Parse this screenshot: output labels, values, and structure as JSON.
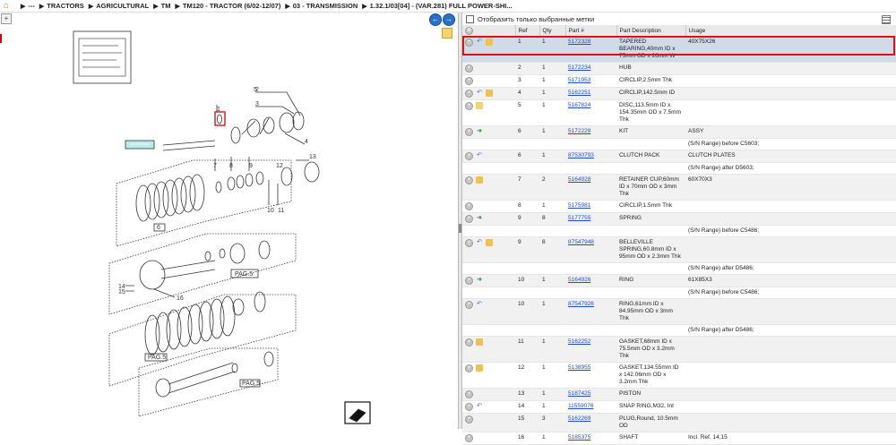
{
  "breadcrumb": {
    "items": [
      "---",
      "TRACTORS",
      "AGRICULTURAL",
      "TM",
      "TM120 - TRACTOR (6/02-12/07)",
      "03 - TRANSMISSION",
      "1.32.1/03[04] - (VAR.281) FULL POWER-SHI..."
    ]
  },
  "left": {
    "expand_icon": "+",
    "nav_back": "←",
    "nav_forward": "→"
  },
  "diagram": {
    "labels": [
      "1",
      "2",
      "3",
      "4",
      "5",
      "6",
      "7",
      "8",
      "9",
      "10",
      "11",
      "12",
      "13",
      "14",
      "15",
      "16"
    ],
    "page_labels": [
      "6",
      "PAG.5",
      "PAG.5",
      "PAG.5"
    ]
  },
  "right": {
    "filter_label": "Отобразить только выбранные метки",
    "columns": [
      "",
      "Ref",
      "Qty",
      "Part #",
      "Part Description",
      "Usage"
    ],
    "rows": [
      {
        "icons": [
          "back",
          "box"
        ],
        "ref": "1",
        "qty": "1",
        "part": "5172328",
        "desc": "TAPERED BEARING,40mm ID x 75mm OD x 26mm W",
        "usage": "40X75X26",
        "sel": true
      },
      {
        "icons": [],
        "ref": "2",
        "qty": "1",
        "part": "5172234",
        "desc": "HUB",
        "usage": ""
      },
      {
        "icons": [],
        "ref": "3",
        "qty": "1",
        "part": "5171953",
        "desc": "CIRCLIP,2.5mm Thk",
        "usage": ""
      },
      {
        "icons": [
          "back",
          "box"
        ],
        "ref": "4",
        "qty": "1",
        "part": "5162251",
        "desc": "CIRCLIP,142.5mm ID",
        "usage": ""
      },
      {
        "icons": [
          "note"
        ],
        "ref": "5",
        "qty": "1",
        "part": "5167824",
        "desc": "DISC,113.5mm ID x 154.35mm OD x 7.5mm Thk",
        "usage": ""
      },
      {
        "icons": [
          "green"
        ],
        "ref": "6",
        "qty": "1",
        "part": "5172229",
        "desc": "KIT",
        "usage": "ASSY"
      },
      {
        "icons": [],
        "ref": "",
        "qty": "",
        "part": "",
        "desc": "",
        "usage": "(S/N Range) before C5603;",
        "blank": true
      },
      {
        "icons": [
          "back"
        ],
        "ref": "6",
        "qty": "1",
        "part": "87530793",
        "desc": "CLUTCH PACK",
        "usage": "CLUTCH PLATES"
      },
      {
        "icons": [],
        "ref": "",
        "qty": "",
        "part": "",
        "desc": "",
        "usage": "(S/N Range) after D5603;",
        "blank": true
      },
      {
        "icons": [
          "box"
        ],
        "ref": "7",
        "qty": "2",
        "part": "5164928",
        "desc": "RETAINER CUP,60mm ID x 70mm OD x 3mm Thk",
        "usage": "60X70X3"
      },
      {
        "icons": [],
        "ref": "8",
        "qty": "1",
        "part": "5175981",
        "desc": "CIRCLIP,1.5mm Thk",
        "usage": ""
      },
      {
        "icons": [
          "green"
        ],
        "ref": "9",
        "qty": "8",
        "part": "5177755",
        "desc": "SPRING",
        "usage": ""
      },
      {
        "icons": [],
        "ref": "",
        "qty": "",
        "part": "",
        "desc": "",
        "usage": "(S/N Range) before C5486;",
        "blank": true
      },
      {
        "icons": [
          "back",
          "box"
        ],
        "ref": "9",
        "qty": "8",
        "part": "87547948",
        "desc": "BELLEVILLE SPRING,60.8mm ID x 95mm OD x 2.3mm Thk",
        "usage": ""
      },
      {
        "icons": [],
        "ref": "",
        "qty": "",
        "part": "",
        "desc": "",
        "usage": "(S/N Range) after D5486;",
        "blank": true
      },
      {
        "icons": [
          "green"
        ],
        "ref": "10",
        "qty": "1",
        "part": "5164926",
        "desc": "RING",
        "usage": "61X85X3"
      },
      {
        "icons": [],
        "ref": "",
        "qty": "",
        "part": "",
        "desc": "",
        "usage": "(S/N Range) before C5486;",
        "blank": true
      },
      {
        "icons": [
          "back"
        ],
        "ref": "10",
        "qty": "1",
        "part": "87547926",
        "desc": "RING,61mm ID x 84.95mm OD x 3mm Thk",
        "usage": ""
      },
      {
        "icons": [],
        "ref": "",
        "qty": "",
        "part": "",
        "desc": "",
        "usage": "(S/N Range) after D5486;",
        "blank": true
      },
      {
        "icons": [
          "box"
        ],
        "ref": "11",
        "qty": "1",
        "part": "5162252",
        "desc": "GASKET,68mm ID x 75.5mm OD x 3.2mm Thk",
        "usage": ""
      },
      {
        "icons": [
          "box"
        ],
        "ref": "12",
        "qty": "1",
        "part": "5138955",
        "desc": "GASKET,134.55mm ID x 142.06mm OD x 3.2mm Thk",
        "usage": ""
      },
      {
        "icons": [],
        "ref": "13",
        "qty": "1",
        "part": "5187425",
        "desc": "PISTON",
        "usage": ""
      },
      {
        "icons": [
          "back"
        ],
        "ref": "14",
        "qty": "1",
        "part": "11559076",
        "desc": "SNAP RING,M32, Int",
        "usage": ""
      },
      {
        "icons": [],
        "ref": "15",
        "qty": "3",
        "part": "5162269",
        "desc": "PLUG,Round, 10.5mm OD",
        "usage": ""
      },
      {
        "icons": [],
        "ref": "16",
        "qty": "1",
        "part": "5185375",
        "desc": "SHAFT",
        "usage": "Incl. Ref. 14,15"
      }
    ]
  }
}
